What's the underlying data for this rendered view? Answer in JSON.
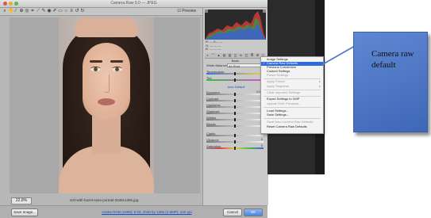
{
  "window": {
    "title": "Camera Raw 9.0 — JPEG"
  },
  "toolbar": {
    "preview_label": "Preview",
    "tools": [
      "zoom-tool",
      "hand-tool",
      "white-balance-tool",
      "color-sampler-tool",
      "targeted-adjustment-tool",
      "crop-tool",
      "straighten-tool",
      "spot-removal-tool",
      "red-eye-tool",
      "adjustment-brush-tool",
      "graduated-filter-tool",
      "radial-filter-tool",
      "preferences-tool",
      "rotate-left-tool",
      "rotate-right-tool"
    ]
  },
  "canvas": {
    "zoom": "22.8%",
    "filename": "Girl-with-hazel-eyes-portrait-2048x1365.jpg"
  },
  "histogram": {
    "info_lines": [
      "R: ---  f/---  ---",
      "G: ---  ---  ---",
      "B: ---  ---  ---"
    ]
  },
  "panel": {
    "tabs": [
      "basic",
      "tone-curve",
      "detail",
      "hsl",
      "split-toning",
      "lens",
      "effects",
      "camera-calibration",
      "presets",
      "snapshots"
    ],
    "header": "Basic",
    "white_balance_label": "White Balance:",
    "white_balance_value": "As Shot",
    "auto_default": "Auto   Default",
    "sliders": [
      {
        "label": "Temperature",
        "value": "0"
      },
      {
        "label": "Tint",
        "value": "0"
      },
      {
        "label": "Exposure",
        "value": "0.00"
      },
      {
        "label": "Contrast",
        "value": "0"
      },
      {
        "label": "Highlights",
        "value": "0"
      },
      {
        "label": "Shadows",
        "value": "0"
      },
      {
        "label": "Whites",
        "value": "0"
      },
      {
        "label": "Blacks",
        "value": "0"
      },
      {
        "label": "Clarity",
        "value": "0"
      },
      {
        "label": "Vibrance",
        "value": "0"
      },
      {
        "label": "Saturation",
        "value": "0"
      }
    ]
  },
  "menu": {
    "items": [
      {
        "label": "Image Settings",
        "state": "normal"
      },
      {
        "label": "Camera Raw Defaults",
        "state": "selected",
        "check": "✓"
      },
      {
        "label": "Previous Conversion",
        "state": "normal"
      },
      {
        "label": "Custom Settings",
        "state": "normal"
      },
      {
        "label": "Preset Settings",
        "state": "disabled"
      },
      {
        "label": "Apply Preset",
        "state": "disabled",
        "arrow": "▸"
      },
      {
        "label": "Apply Snapshot",
        "state": "disabled",
        "arrow": "▸"
      },
      {
        "label": "Clear Imported Settings",
        "state": "disabled"
      },
      {
        "label": "Export Settings to XMP",
        "state": "normal"
      },
      {
        "label": "Update DNG Previews...",
        "state": "disabled"
      },
      {
        "label": "Load Settings...",
        "state": "normal"
      },
      {
        "label": "Save Settings...",
        "state": "normal"
      },
      {
        "label": "Save New Camera Raw Defaults",
        "state": "disabled"
      },
      {
        "label": "Reset Camera Raw Defaults",
        "state": "normal"
      }
    ]
  },
  "bottom": {
    "save_image": "Save Image...",
    "workflow_link": "Adobe RGB (1998); 8 bit; 2048 by 1365 (2.8MP); 240 ppi",
    "cancel": "Cancel",
    "ok": "OK"
  },
  "callout": {
    "text": "Camera raw default",
    "color": "#4f78c6"
  }
}
